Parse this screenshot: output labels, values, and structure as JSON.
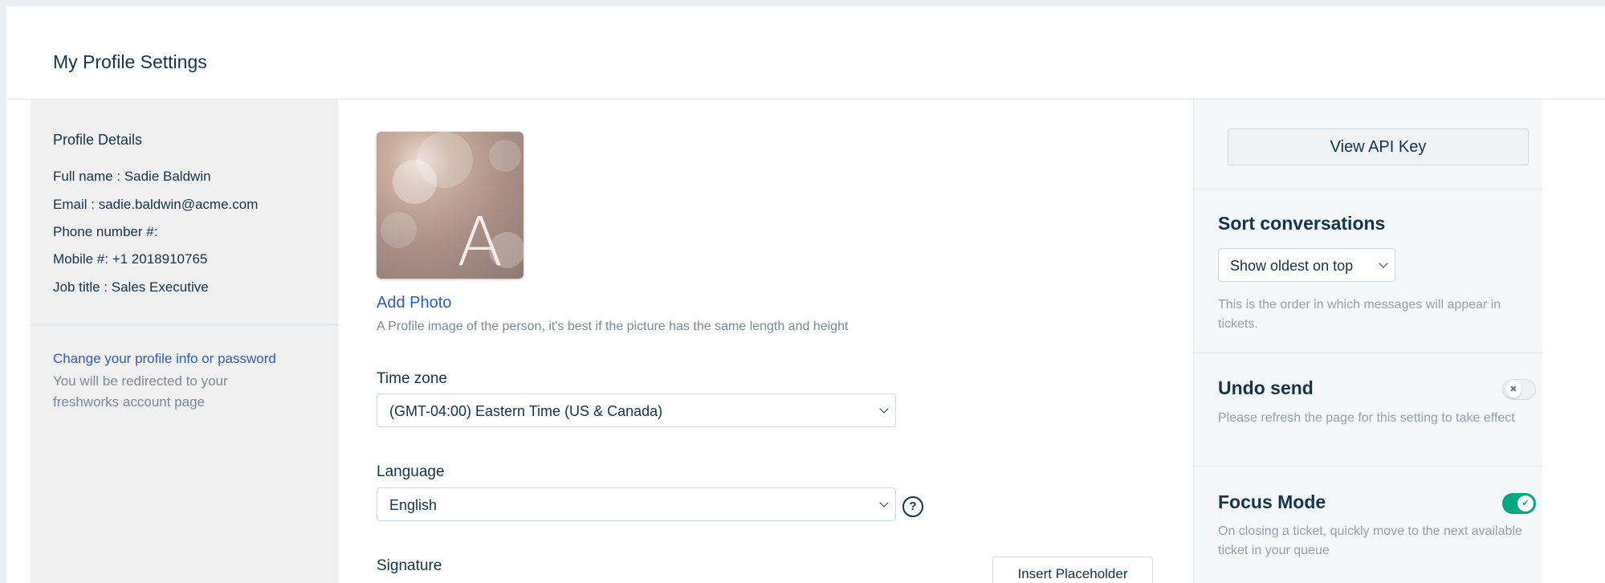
{
  "page": {
    "title": "My Profile Settings"
  },
  "profile": {
    "heading": "Profile Details",
    "fields": [
      {
        "label": "Full name : ",
        "value": "Sadie Baldwin"
      },
      {
        "label": "Email : ",
        "value": "sadie.baldwin@acme.com"
      },
      {
        "label": "Phone number #:",
        "value": ""
      },
      {
        "label": "Mobile #: ",
        "value": "+1 2018910765"
      },
      {
        "label": "Job title : ",
        "value": "Sales Executive"
      }
    ],
    "change_link": "Change your profile info or password",
    "redirect_note": "You will be redirected to your freshworks account page"
  },
  "photo": {
    "avatar_letter": "A",
    "add_label": "Add Photo",
    "hint": "A Profile image of the person, it's best if the picture has the same length and height"
  },
  "timezone": {
    "label": "Time zone",
    "selected": "(GMT-04:00) Eastern Time (US & Canada)"
  },
  "language": {
    "label": "Language",
    "selected": "English",
    "help_glyph": "?"
  },
  "signature": {
    "label": "Signature",
    "insert_button": "Insert Placeholder"
  },
  "api": {
    "button": "View API Key"
  },
  "sort": {
    "heading": "Sort conversations",
    "selected": "Show oldest on top",
    "description": "This is the order in which messages will appear in tickets."
  },
  "undo_send": {
    "heading": "Undo send",
    "description": "Please refresh the page for this setting to take effect",
    "enabled": false,
    "glyph": "✖"
  },
  "focus_mode": {
    "heading": "Focus Mode",
    "description": "On closing a ticket, quickly move to the next available ticket in your queue",
    "enabled": true,
    "glyph": "✔"
  },
  "colors": {
    "accent": "#2c5cc5",
    "toggle_on": "#00a886",
    "text": "#12344d"
  },
  "icons": {
    "select_arrow": "chevron-down-icon",
    "help": "help-circle-icon"
  }
}
